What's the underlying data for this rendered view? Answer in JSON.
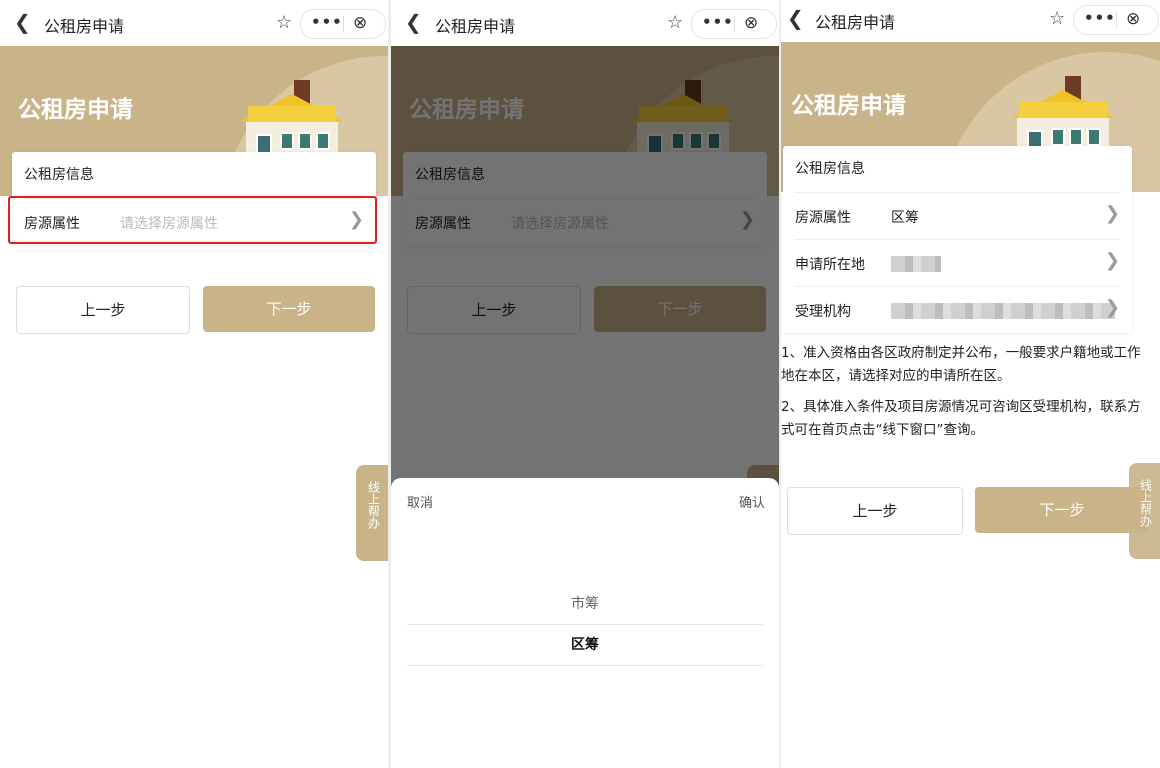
{
  "header": {
    "title": "公租房申请",
    "back_icon": "chevron-left-icon",
    "star_icon": "star-outline-icon",
    "more_icon": "more-dots-icon",
    "close_icon": "close-circle-icon"
  },
  "banner": {
    "title": "公租房申请"
  },
  "card": {
    "title": "公租房信息"
  },
  "step1": {
    "field_label": "房源属性",
    "field_placeholder": "请选择房源属性",
    "prev": "上一步",
    "next": "下一步",
    "help": "线上帮办"
  },
  "picker": {
    "cancel": "取消",
    "confirm": "确认",
    "options": [
      "市筹",
      "区筹"
    ],
    "selected": "区筹"
  },
  "step3": {
    "rows": [
      {
        "label": "房源属性",
        "value": "区筹"
      },
      {
        "label": "申请所在地",
        "value": ""
      },
      {
        "label": "受理机构",
        "value": ""
      }
    ],
    "notes": [
      "1、准入资格由各区政府制定并公布，一般要求户籍地或工作地在本区，请选择对应的申请所在区。",
      "2、具体准入条件及项目房源情况可咨询区受理机构，联系方式可在首页点击“线下窗口”查询。"
    ]
  },
  "colors": {
    "brand": "#c9b489",
    "highlight_border": "#e02020"
  }
}
